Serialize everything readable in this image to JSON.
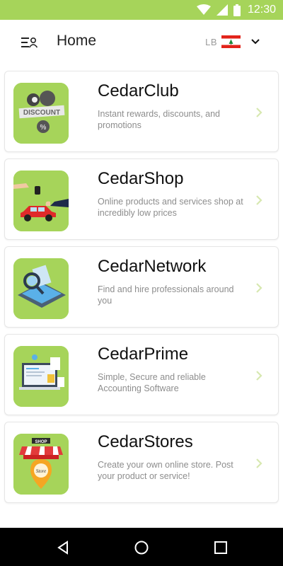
{
  "status_bar": {
    "time": "12:30",
    "color": "#a6d45a"
  },
  "header": {
    "title": "Home",
    "locale_code": "LB",
    "menu_icon": "menu-profile-icon",
    "dropdown_icon": "chevron-down-icon"
  },
  "cards": [
    {
      "title": "CedarClub",
      "description": "Instant rewards, discounts, and promotions",
      "icon": "discount-tag-icon"
    },
    {
      "title": "CedarShop",
      "description": "Online products and services shop at incredibly low prices",
      "icon": "car-key-icon"
    },
    {
      "title": "CedarNetwork",
      "description": "Find and hire professionals around you",
      "icon": "magnifier-tablet-icon"
    },
    {
      "title": "CedarPrime",
      "description": "Simple, Secure and reliable Accounting Software",
      "icon": "accounting-laptop-icon"
    },
    {
      "title": "CedarStores",
      "description": "Create your own online store. Post your product or service!",
      "icon": "shop-pin-icon"
    }
  ],
  "nav_bar": {
    "icons": [
      "back-icon",
      "home-icon",
      "recents-icon"
    ]
  },
  "colors": {
    "accent": "#a6d45a",
    "arrow": "#d7e8b0",
    "text_muted": "#8d8d8d"
  }
}
